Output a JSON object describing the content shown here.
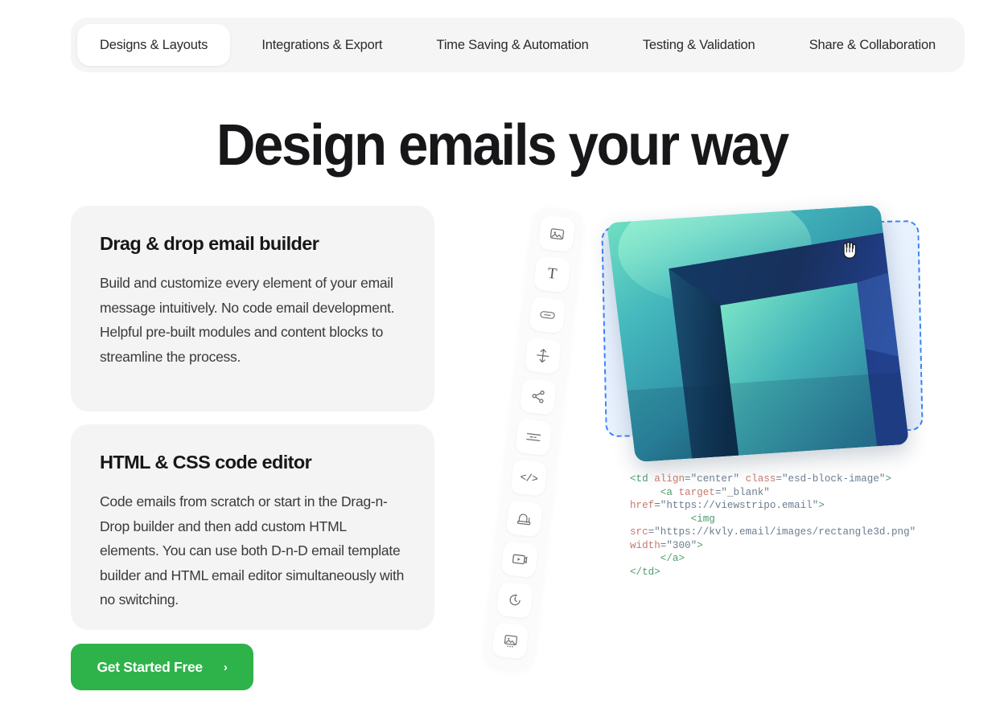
{
  "tabs": [
    {
      "label": "Designs & Layouts",
      "active": true
    },
    {
      "label": "Integrations & Export",
      "active": false
    },
    {
      "label": "Time Saving & Automation",
      "active": false
    },
    {
      "label": "Testing & Validation",
      "active": false
    },
    {
      "label": "Share & Collaboration",
      "active": false
    }
  ],
  "heading": "Design emails your way",
  "cards": [
    {
      "title": "Drag & drop email builder",
      "body": "Build and customize every element of your email message intuitively. No code email development. Helpful pre-built modules and content blocks to streamline the process."
    },
    {
      "title": "HTML & CSS code editor",
      "body": "Code emails from scratch or start in the Drag-n-Drop builder and then add custom HTML elements. You can use both D-n-D email template builder and HTML email editor simultaneously with no switching."
    }
  ],
  "cta": {
    "label": "Get Started Free",
    "chevron": "›"
  },
  "builder": {
    "toolbar": [
      {
        "icon": "image-icon",
        "name": "image"
      },
      {
        "icon": "text-icon",
        "name": "text",
        "glyph": "T"
      },
      {
        "icon": "button-icon",
        "name": "button"
      },
      {
        "icon": "spacer-icon",
        "name": "spacer"
      },
      {
        "icon": "social-share-icon",
        "name": "social"
      },
      {
        "icon": "divider-icon",
        "name": "divider"
      },
      {
        "icon": "code-icon",
        "name": "html",
        "glyph": "</>"
      },
      {
        "icon": "banner-icon",
        "name": "banner"
      },
      {
        "icon": "video-icon",
        "name": "video"
      },
      {
        "icon": "timer-icon",
        "name": "timer"
      },
      {
        "icon": "carousel-icon",
        "name": "carousel"
      }
    ],
    "cursor": "grab-hand-cursor",
    "dropzone_label": "image drop zone",
    "code_lines": [
      {
        "parts": [
          {
            "t": "<td ",
            "c": "c-tag"
          },
          {
            "t": "align",
            "c": "c-attr"
          },
          {
            "t": "=\"center\" ",
            "c": "c-val"
          },
          {
            "t": "class",
            "c": "c-attr"
          },
          {
            "t": "=\"esd-block-image\"",
            "c": "c-val"
          },
          {
            "t": ">",
            "c": "c-tag"
          }
        ]
      },
      {
        "parts": [
          {
            "t": "     <a ",
            "c": "c-tag"
          },
          {
            "t": "target",
            "c": "c-attr"
          },
          {
            "t": "=\"_blank\" ",
            "c": "c-val"
          },
          {
            "t": "href",
            "c": "c-attr"
          },
          {
            "t": "=\"https://viewstripo.email\"",
            "c": "c-val"
          },
          {
            "t": ">",
            "c": "c-tag"
          }
        ]
      },
      {
        "parts": [
          {
            "t": "          <img ",
            "c": "c-tag"
          },
          {
            "t": "src",
            "c": "c-attr"
          },
          {
            "t": "=\"https://kvly.email/images/rectangle3d.png\" ",
            "c": "c-val"
          },
          {
            "t": "width",
            "c": "c-attr"
          },
          {
            "t": "=\"300\"",
            "c": "c-val"
          },
          {
            "t": ">",
            "c": "c-tag"
          }
        ]
      },
      {
        "parts": [
          {
            "t": "     </a>",
            "c": "c-tag"
          }
        ]
      },
      {
        "parts": [
          {
            "t": "</td>",
            "c": "c-tag"
          }
        ]
      }
    ]
  },
  "colors": {
    "accent_green": "#2eb24a",
    "dropzone_blue": "#3b82f6",
    "dropzone_fill": "#e8f1fe",
    "card_bg": "#f4f4f4",
    "tabbar_bg": "#f5f5f5",
    "heading": "#17171a",
    "image_teal": "#3fb8b2",
    "image_navy": "#16365f"
  }
}
